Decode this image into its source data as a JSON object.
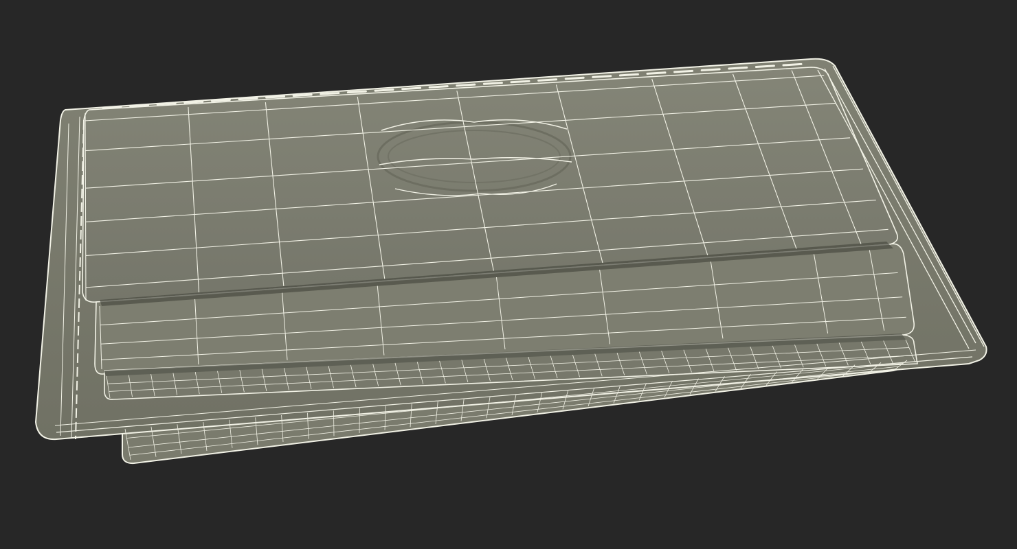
{
  "scene": {
    "background_color": "#272727",
    "surface_color": "#7b7c6d",
    "surface_light_color": "#848577",
    "surface_dark_color": "#6a6b5e",
    "wire_color": "#f2f2e6",
    "emboss_color": "#6f7063"
  },
  "model": {
    "subject": "card-holder-wallet",
    "render_mode": "wireframe-on-shaded",
    "card_slots_visible": 3
  }
}
